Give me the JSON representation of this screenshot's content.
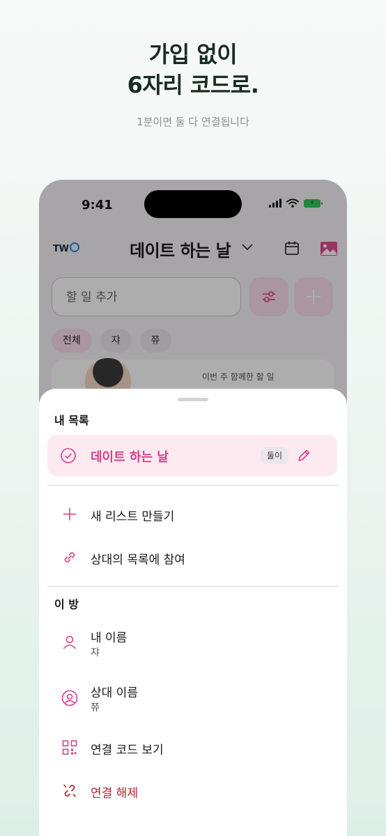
{
  "hero": {
    "title_line1": "가입 없이",
    "title_line2": "6자리 코드로.",
    "subtitle": "1분이면 둘 다 연결됩니다"
  },
  "status_bar": {
    "time": "9:41",
    "battery_icon": "charging-battery-icon"
  },
  "app_header": {
    "logo": "TWO",
    "title": "데이트 하는 날"
  },
  "todo_input": {
    "placeholder": "할 일 추가"
  },
  "filter_chips": [
    {
      "label": "전체",
      "active": true
    },
    {
      "label": "쟈",
      "active": false
    },
    {
      "label": "쮸",
      "active": false
    }
  ],
  "week_card": {
    "text": "이번 주 함께한 할 일"
  },
  "sheet": {
    "my_lists_label": "내 목록",
    "selected_list": {
      "label": "데이트 하는 날",
      "badge": "둘이"
    },
    "new_list_label": "새 리스트 만들기",
    "join_list_label": "상대의 목록에 참여",
    "room_label": "이 방",
    "my_name": {
      "label": "내 이름",
      "value": "쟈"
    },
    "partner_name": {
      "label": "상대 이름",
      "value": "쮸"
    },
    "view_code_label": "연결 코드 보기",
    "disconnect_label": "연결 해제"
  },
  "colors": {
    "accent": "#d6418a",
    "danger": "#b3232f",
    "selected_bg": "#fdeaf1"
  }
}
